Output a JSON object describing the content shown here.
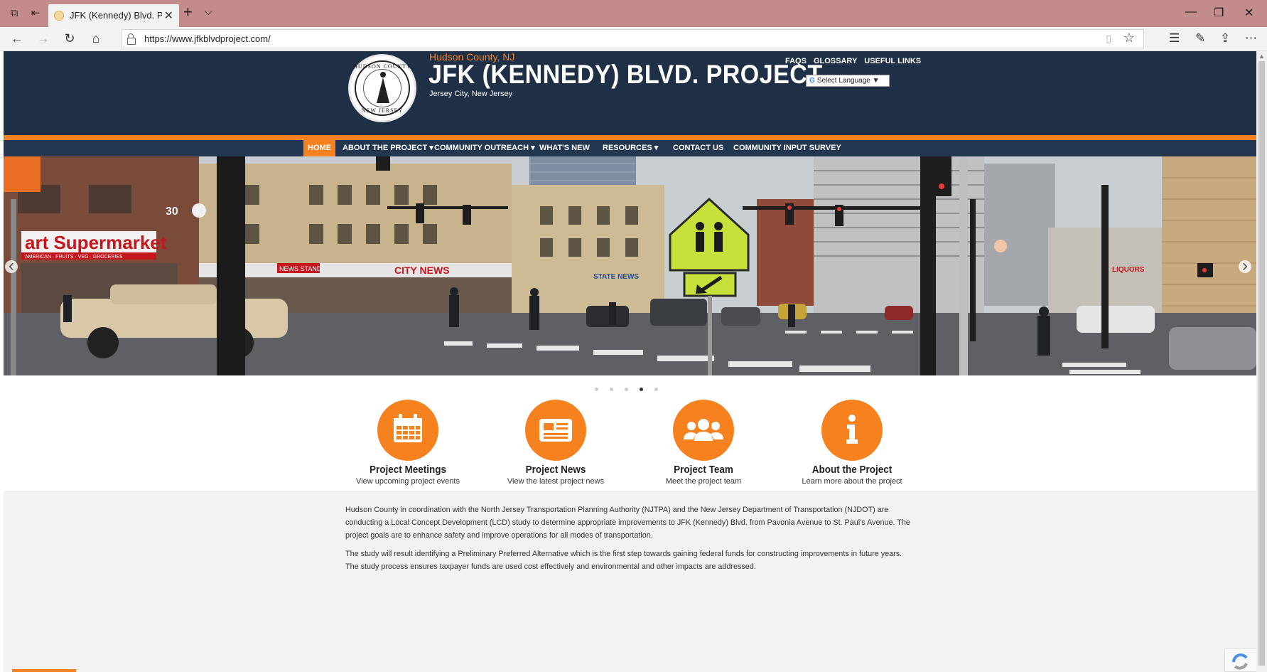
{
  "browser": {
    "tab_title": "JFK (Kennedy) Blvd. Proj",
    "url": "https://www.jfkblvdproject.com/"
  },
  "header": {
    "county": "Hudson County, NJ",
    "title": "JFK (KENNEDY) BLVD. PROJECT",
    "city": "Jersey City, New Jersey",
    "seal_top": "HUDSON COUNTY",
    "seal_bottom": "NEW JERSEY",
    "top_links": [
      "FAQS",
      "GLOSSARY",
      "USEFUL LINKS"
    ],
    "language_select": "Select Language"
  },
  "nav": {
    "items": [
      {
        "label": "HOME",
        "dropdown": false,
        "active": true
      },
      {
        "label": "ABOUT THE PROJECT",
        "dropdown": true,
        "active": false
      },
      {
        "label": "COMMUNITY OUTREACH",
        "dropdown": true,
        "active": false
      },
      {
        "label": "WHAT'S NEW",
        "dropdown": false,
        "active": false
      },
      {
        "label": "RESOURCES",
        "dropdown": true,
        "active": false
      },
      {
        "label": "CONTACT US",
        "dropdown": false,
        "active": false
      },
      {
        "label": "COMMUNITY INPUT SURVEY",
        "dropdown": false,
        "active": false
      }
    ]
  },
  "slider": {
    "slide_count": 5,
    "active_index": 3,
    "signs": {
      "supermarket": "art Supermarket",
      "supermarket_sub": "AMERICAN · FRUITS · VEG · GROCERIES",
      "city_news": "CITY NEWS",
      "state_news": "STATE NEWS",
      "news_stand": "NEWS STAND",
      "liquors": "LIQUORS",
      "building_number": "30"
    }
  },
  "features": [
    {
      "title": "Project Meetings",
      "subtitle": "View upcoming project events",
      "icon": "calendar-icon"
    },
    {
      "title": "Project News",
      "subtitle": "View the latest project news",
      "icon": "newspaper-icon"
    },
    {
      "title": "Project Team",
      "subtitle": "Meet the project team",
      "icon": "team-icon"
    },
    {
      "title": "About the Project",
      "subtitle": "Learn more about the project",
      "icon": "info-icon"
    }
  ],
  "intro": {
    "paragraph1": "Hudson County in coordination with the North Jersey Transportation Planning Authority (NJTPA) and the New Jersey Department of Transportation (NJDOT) are conducting a Local Concept Development (LCD) study to determine appropriate improvements to JFK (Kennedy) Blvd. from Pavonia Avenue to St. Paul's Avenue. The project goals are to enhance safety and improve operations for all modes of transportation.",
    "paragraph2": "The study will result identifying a Preliminary Preferred Alternative which is the first step towards gaining federal funds for constructing improvements in future years. The study process ensures taxpayer funds are used cost effectively and environmental and other impacts are addressed."
  },
  "colors": {
    "header_bg": "#1f3046",
    "accent": "#f5821f",
    "nav_bg": "#233850",
    "intro_bg": "#f2f2f2"
  }
}
